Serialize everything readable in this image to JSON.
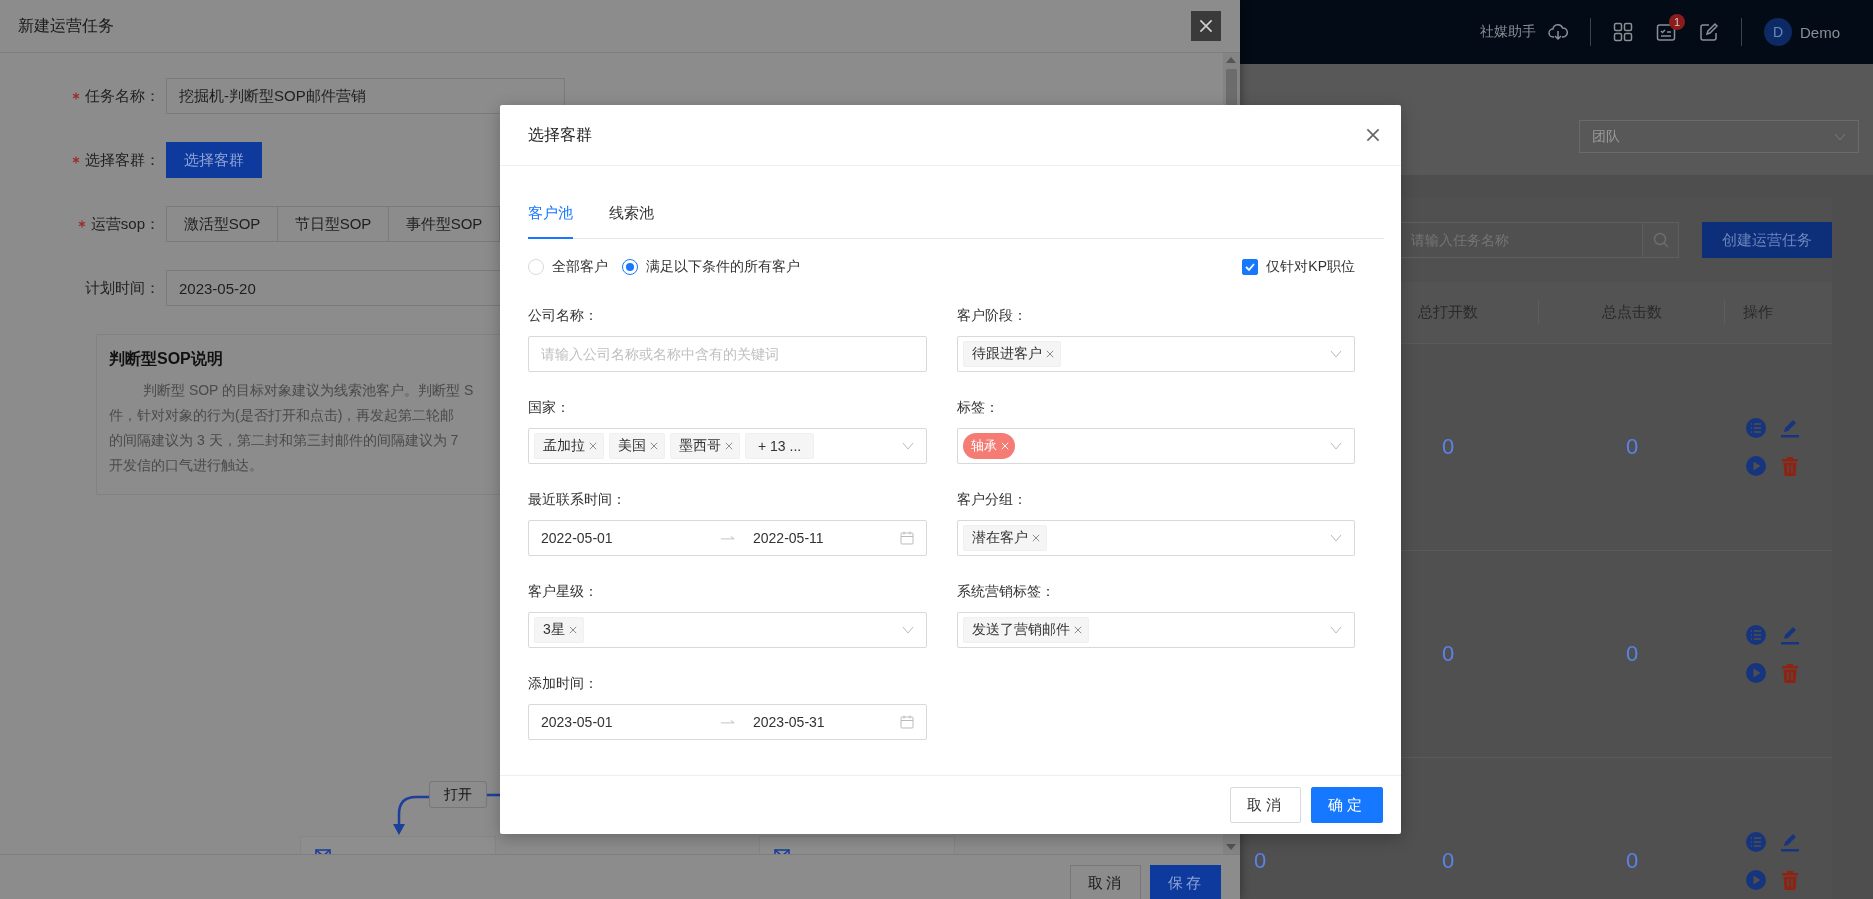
{
  "app_header": {
    "assistant_label": "社媒助手",
    "notification_count": "1",
    "avatar_letter": "D",
    "user_name": "Demo"
  },
  "task_page": {
    "team_select": {
      "placeholder": "团队"
    },
    "search": {
      "placeholder": "请输入任务名称"
    },
    "create_button": "创建运营任务",
    "table": {
      "columns": [
        "总打开数",
        "总点击数",
        "操作"
      ],
      "rows": [
        {
          "open_count": "0",
          "click_count": "0"
        },
        {
          "open_count": "0",
          "click_count": "0"
        },
        {
          "column_1": "0",
          "open_count": "0",
          "click_count": "0"
        }
      ]
    }
  },
  "drawer": {
    "title": "新建运营任务",
    "fields": [
      {
        "kind": "input",
        "label": "任务名称：",
        "required": true,
        "value": "挖掘机-判断型SOP邮件营销"
      },
      {
        "kind": "button",
        "label": "选择客群：",
        "required": true,
        "button": "选择客群"
      },
      {
        "kind": "segments",
        "label": "运营sop：",
        "required": true,
        "options": [
          "激活型SOP",
          "节日型SOP",
          "事件型SOP"
        ]
      },
      {
        "kind": "input",
        "label": "计划时间：",
        "required": false,
        "value": "2023-05-20"
      }
    ],
    "info": {
      "title": "判断型SOP说明",
      "lines": [
        "判断型 SOP 的目标对象建议为线索池客户。判断型 S",
        "件，针对对象的行为(是否打开和点击)，再发起第二轮邮",
        "的间隔建议为 3 天，第二封和第三封邮件的间隔建议为 7",
        "开发信的口气进行触达。"
      ]
    },
    "flow": {
      "edge_label": "打开"
    },
    "buttons": [
      {
        "label": "取消",
        "kind": "default"
      },
      {
        "label": "保存",
        "kind": "primary"
      }
    ]
  },
  "modal": {
    "title": "选择客群",
    "tabs": [
      {
        "label": "客户池",
        "selected": true
      },
      {
        "label": "线索池",
        "selected": false
      }
    ],
    "scope_options": [
      {
        "label": "全部客户",
        "selected": false
      },
      {
        "label": "满足以下条件的所有客户",
        "selected": true
      }
    ],
    "kp_only": {
      "label": "仅针对KP职位",
      "checked": true
    },
    "fields": [
      {
        "kind": "text",
        "label": "公司名称：",
        "placeholder": "请输入公司名称或名称中含有的关键词"
      },
      {
        "kind": "select",
        "label": "客户阶段：",
        "tags": [
          {
            "kind": "tag",
            "label": "待跟进客户"
          }
        ]
      },
      {
        "kind": "select",
        "label": "国家：",
        "tags": [
          {
            "kind": "tag",
            "label": "孟加拉"
          },
          {
            "kind": "tag",
            "label": "美国"
          },
          {
            "kind": "tag",
            "label": "墨西哥"
          },
          {
            "kind": "more",
            "label": "+ 13 ..."
          }
        ]
      },
      {
        "kind": "select",
        "label": "标签：",
        "tags": [
          {
            "kind": "tag",
            "label": "轴承",
            "color": "#f47c74"
          }
        ]
      },
      {
        "kind": "daterange",
        "label": "最近联系时间：",
        "start": "2022-05-01",
        "end": "2022-05-11"
      },
      {
        "kind": "select",
        "label": "客户分组：",
        "tags": [
          {
            "kind": "tag",
            "label": "潜在客户"
          }
        ]
      },
      {
        "kind": "select",
        "label": "客户星级：",
        "tags": [
          {
            "kind": "tag",
            "label": "3星"
          }
        ]
      },
      {
        "kind": "select",
        "label": "系统营销标签：",
        "tags": [
          {
            "kind": "tag",
            "label": "发送了营销邮件"
          }
        ]
      },
      {
        "kind": "daterange",
        "label": "添加时间：",
        "start": "2023-05-01",
        "end": "2023-05-31"
      }
    ],
    "buttons": [
      {
        "label": "取消",
        "kind": "default"
      },
      {
        "label": "确定",
        "kind": "primary"
      }
    ]
  }
}
